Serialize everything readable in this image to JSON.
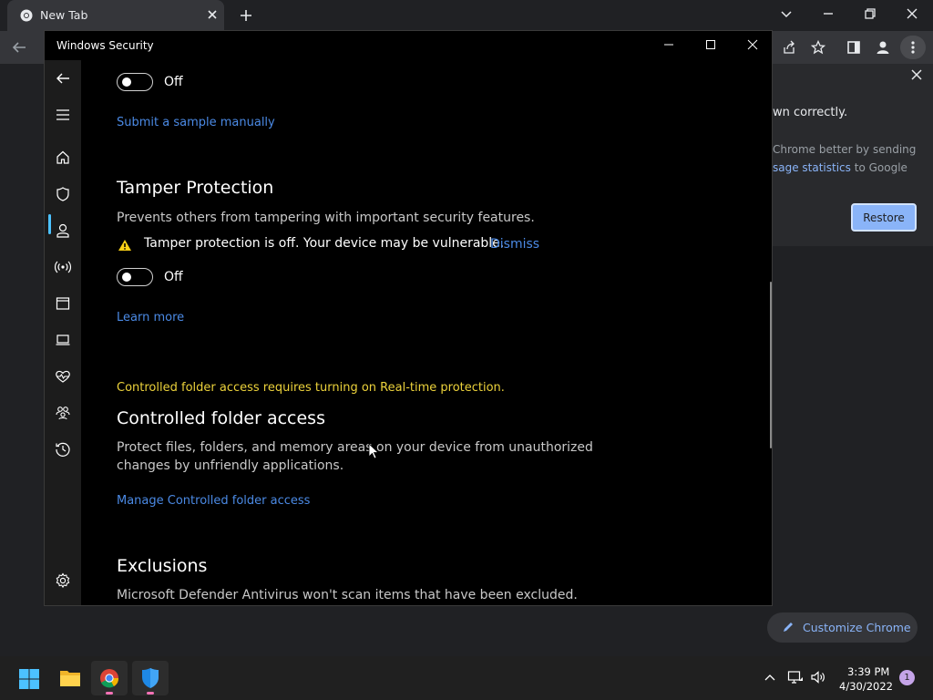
{
  "browser": {
    "tab_title": "New Tab",
    "bubble": {
      "line1": "wn correctly.",
      "line2": "Chrome better by sending",
      "line3_link": "sage statistics",
      "line3_rest": " to Google",
      "restore_label": "Restore"
    },
    "customize_label": "Customize Chrome"
  },
  "window": {
    "title": "Windows Security"
  },
  "content": {
    "toggle1_state": "Off",
    "submit_link": "Submit a sample manually",
    "tamper": {
      "heading": "Tamper Protection",
      "description": "Prevents others from tampering with important security features.",
      "warning": "Tamper protection is off. Your device may be vulnerable.",
      "dismiss": "Dismiss",
      "toggle_state": "Off",
      "learn_more": "Learn more"
    },
    "cfa": {
      "notice": "Controlled folder access requires turning on Real-time protection.",
      "heading": "Controlled folder access",
      "desc_line1": "Protect files, folders, and memory areas on your device from unauthorized",
      "desc_line2": "changes by unfriendly applications.",
      "manage_link": "Manage Controlled folder access"
    },
    "exclusions": {
      "heading": "Exclusions",
      "description": "Microsoft Defender Antivirus won't scan items that have been excluded."
    }
  },
  "taskbar": {
    "time": "3:39 PM",
    "date": "4/30/2022",
    "notification_count": "1"
  },
  "colors": {
    "link": "#4b8ae5",
    "warning_yellow": "#ecd23b",
    "accent": "#4cc2ff"
  }
}
